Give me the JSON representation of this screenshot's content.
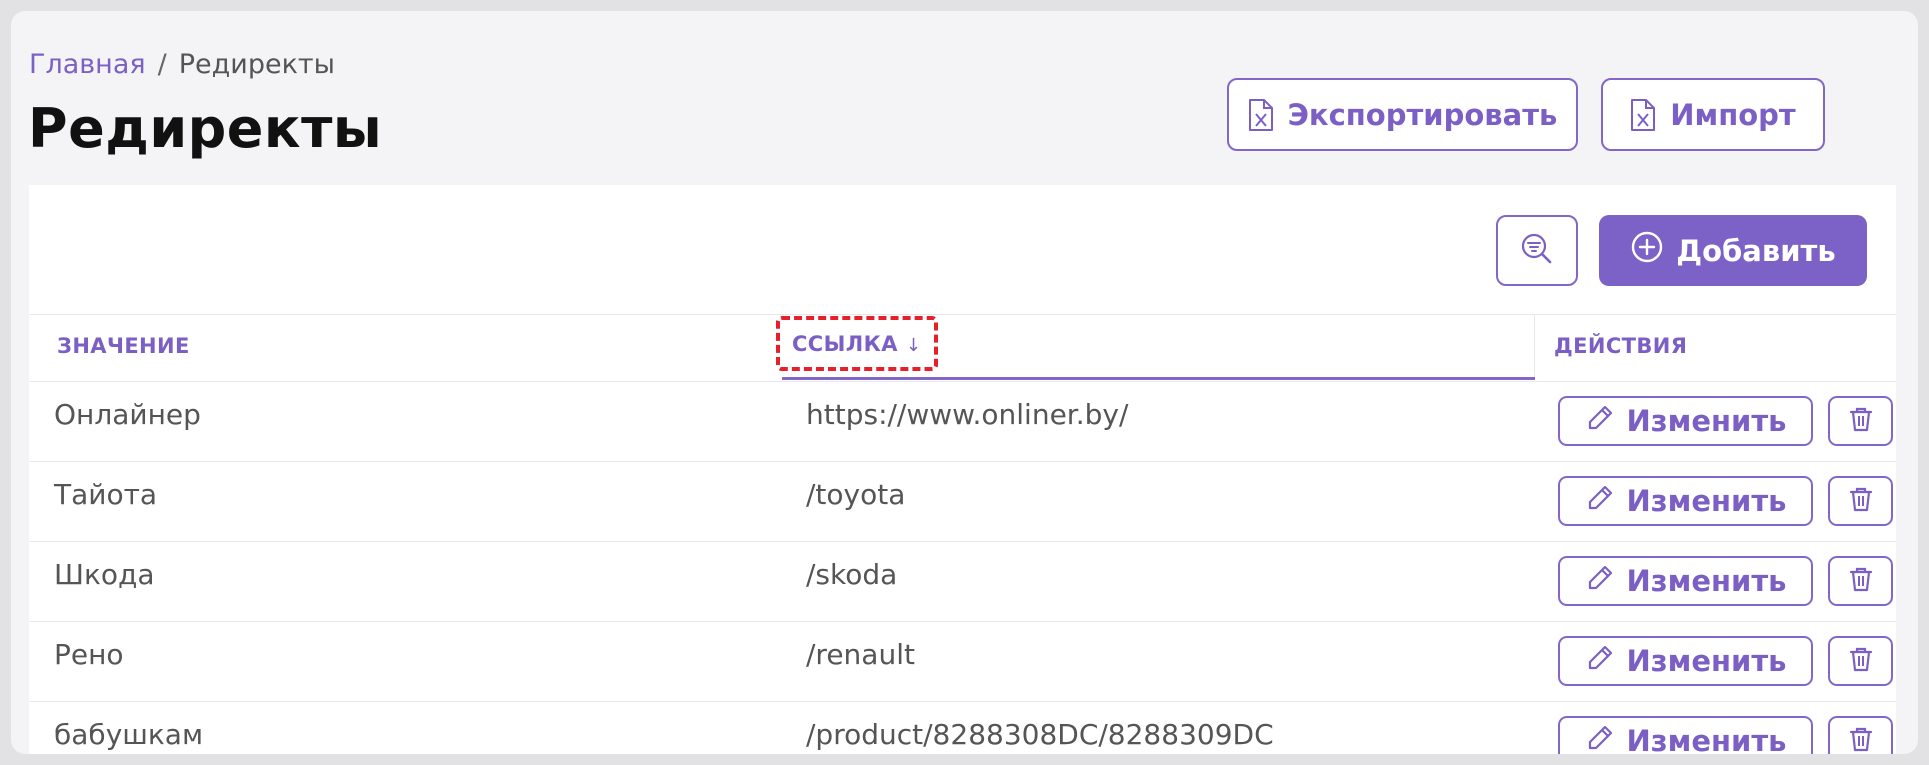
{
  "breadcrumb": {
    "home": "Главная",
    "separator": "/",
    "current": "Редиректы"
  },
  "page": {
    "title": "Редиректы"
  },
  "toolbar": {
    "export_label": "Экспортировать",
    "import_label": "Импорт",
    "add_label": "Добавить"
  },
  "table": {
    "columns": {
      "value": "ЗНАЧЕНИЕ",
      "link": "ССЫЛКА",
      "actions": "ДЕЙСТВИЯ"
    },
    "sort": {
      "column": "ССЫЛКА",
      "direction": "descending",
      "arrow": "↓"
    },
    "edit_label": "Изменить",
    "rows": [
      {
        "value": "Онлайнер",
        "link": "https://www.onliner.by/"
      },
      {
        "value": "Тайота",
        "link": "/toyota"
      },
      {
        "value": "Шкода",
        "link": "/skoda"
      },
      {
        "value": "Рено",
        "link": "/renault"
      },
      {
        "value": "бабушкам",
        "link": "/product/8288308DC/8288309DC"
      }
    ]
  },
  "colors": {
    "accent": "#7c62c6",
    "highlight": "#e5202a",
    "background": "#f4f4f6"
  },
  "icons": {
    "file": "excel-file-icon",
    "filter": "filter-search-icon",
    "add": "plus-circle-icon",
    "edit": "pencil-icon",
    "delete": "trash-icon"
  }
}
